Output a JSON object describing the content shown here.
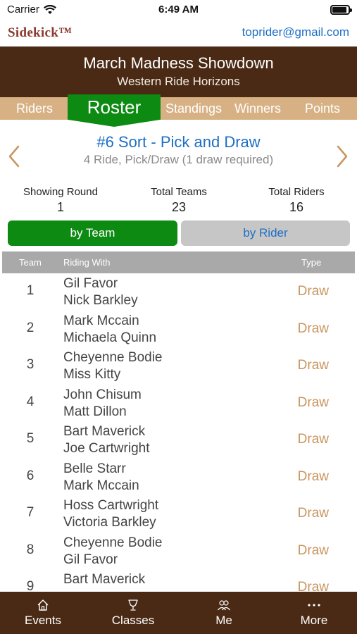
{
  "status": {
    "carrier": "Carrier",
    "time": "6:49 AM"
  },
  "app": {
    "brand": "Sidekick™",
    "user_email": "toprider@gmail.com"
  },
  "event": {
    "title": "March Madness Showdown",
    "subtitle": "Western Ride Horizons"
  },
  "tabs": [
    {
      "label": "Riders"
    },
    {
      "label": "Roster",
      "active": true
    },
    {
      "label": "Standings"
    },
    {
      "label": "Winners"
    },
    {
      "label": "Points"
    }
  ],
  "class_info": {
    "title": "#6 Sort - Pick and Draw",
    "description": "4 Ride, Pick/Draw (1 draw required)"
  },
  "stats": [
    {
      "label": "Showing Round",
      "value": "1"
    },
    {
      "label": "Total Teams",
      "value": "23"
    },
    {
      "label": "Total Riders",
      "value": "16"
    }
  ],
  "segments": {
    "team": "by Team",
    "rider": "by Rider",
    "selected": "team"
  },
  "table": {
    "columns": {
      "team": "Team",
      "riding_with": "Riding With",
      "type": "Type"
    },
    "rows": [
      {
        "team": "1",
        "rider1": "Gil Favor",
        "rider2": "Nick Barkley",
        "type": "Draw"
      },
      {
        "team": "2",
        "rider1": "Mark Mccain",
        "rider2": "Michaela Quinn",
        "type": "Draw"
      },
      {
        "team": "3",
        "rider1": "Cheyenne Bodie",
        "rider2": "Miss Kitty",
        "type": "Draw"
      },
      {
        "team": "4",
        "rider1": "John Chisum",
        "rider2": "Matt Dillon",
        "type": "Draw"
      },
      {
        "team": "5",
        "rider1": "Bart Maverick",
        "rider2": "Joe Cartwright",
        "type": "Draw"
      },
      {
        "team": "6",
        "rider1": "Belle Starr",
        "rider2": "Mark Mccain",
        "type": "Draw"
      },
      {
        "team": "7",
        "rider1": "Hoss Cartwright",
        "rider2": "Victoria Barkley",
        "type": "Draw"
      },
      {
        "team": "8",
        "rider1": "Cheyenne Bodie",
        "rider2": "Gil Favor",
        "type": "Draw"
      },
      {
        "team": "9",
        "rider1": "Bart Maverick",
        "rider2": "",
        "type": "Draw"
      }
    ]
  },
  "tabbar": [
    {
      "label": "Events",
      "icon": "home-icon"
    },
    {
      "label": "Classes",
      "icon": "trophy-icon"
    },
    {
      "label": "Me",
      "icon": "people-icon"
    },
    {
      "label": "More",
      "icon": "more-icon"
    }
  ],
  "colors": {
    "brown": "#4a2a14",
    "tan": "#d7b184",
    "green": "#0c8a12",
    "link_blue": "#1e6fc4",
    "draw_tan": "#c99560"
  }
}
